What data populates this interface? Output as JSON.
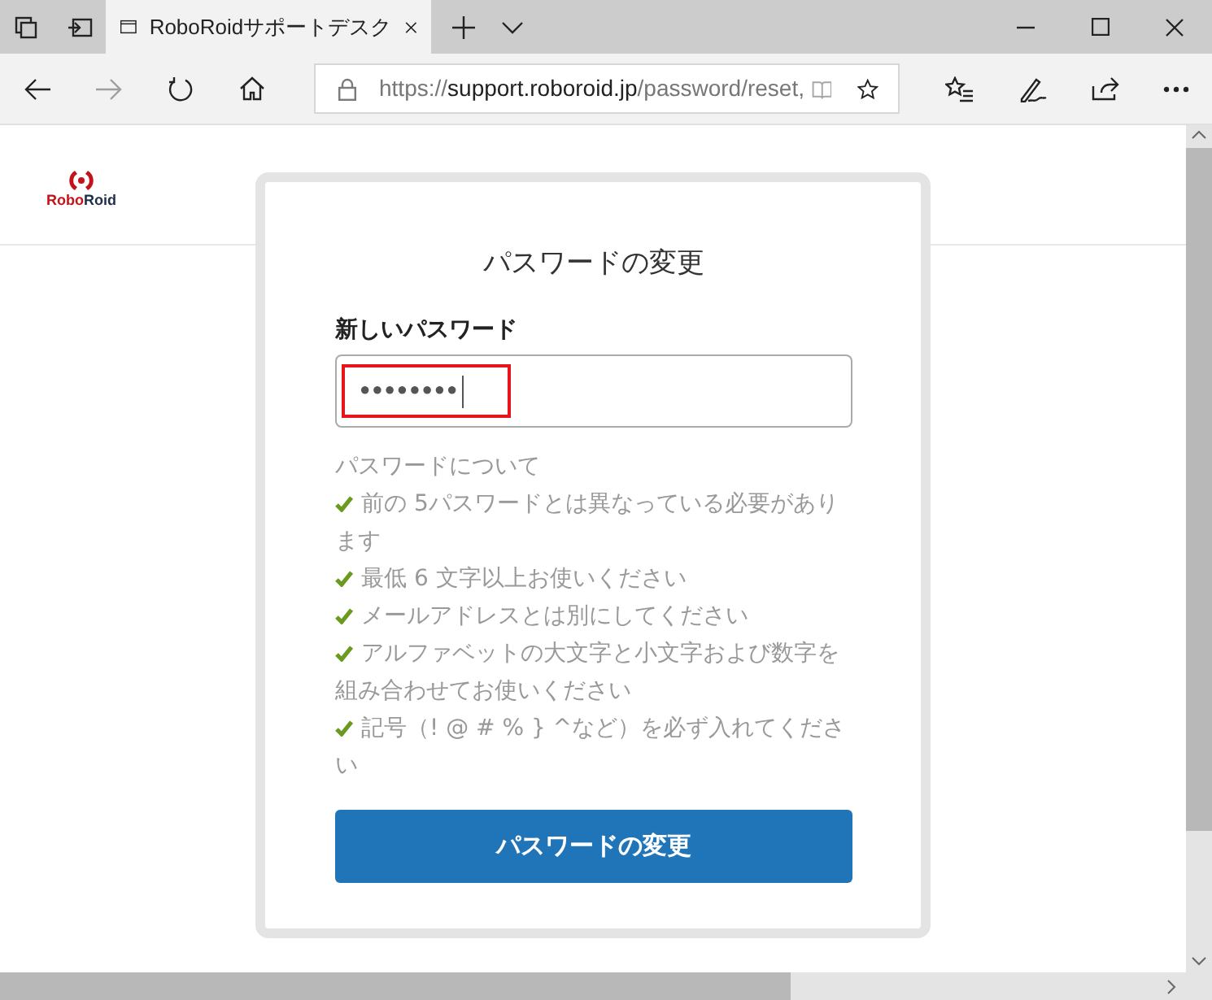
{
  "browser": {
    "tab": {
      "title": "RoboRoidサポートデスク",
      "selected": true
    },
    "address": {
      "scheme": "https://",
      "host": "support.roboroid.jp",
      "path": "/password/reset,"
    }
  },
  "site": {
    "logo": {
      "first": "Robo",
      "second": "Roid"
    }
  },
  "form": {
    "title": "パスワードの変更",
    "field_label": "新しいパスワード",
    "password_value": "●●●●●●●●",
    "highlighted": true,
    "rules_heading": "パスワードについて",
    "rules": [
      {
        "text": "前の 5パスワードとは異なっている必要があります",
        "met": true
      },
      {
        "text": "最低 6 文字以上お使いください",
        "met": true
      },
      {
        "text": "メールアドレスとは別にしてください",
        "met": true
      },
      {
        "text": "アルファベットの大文字と小文字および数字を組み合わせてお使いください",
        "met": true
      },
      {
        "text": "記号（! @ # % } ^など）を必ず入れてください",
        "met": true
      }
    ],
    "submit": "パスワードの変更"
  }
}
